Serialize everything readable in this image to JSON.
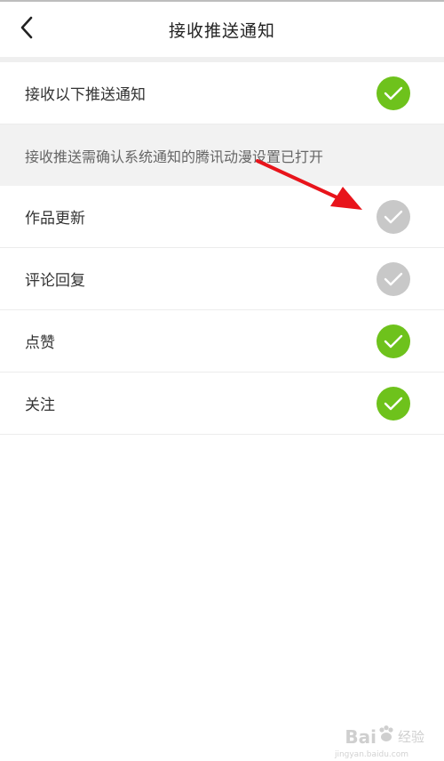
{
  "header": {
    "title": "接收推送通知",
    "back_icon": "chevron-left-icon"
  },
  "master": {
    "label": "接收以下推送通知",
    "checked": true
  },
  "note": "接收推送需确认系统通知的腾讯动漫设置已打开",
  "items": [
    {
      "label": "作品更新",
      "checked": false
    },
    {
      "label": "评论回复",
      "checked": false
    },
    {
      "label": "点赞",
      "checked": true
    },
    {
      "label": "关注",
      "checked": true
    }
  ],
  "colors": {
    "checked": "#6ec21c",
    "unchecked": "#c8c8c8",
    "arrow": "#e8141b"
  },
  "watermark": {
    "brand": "Bai",
    "paw": "paw-icon",
    "suffix": "经验",
    "url": "jingyan.baidu.com"
  }
}
